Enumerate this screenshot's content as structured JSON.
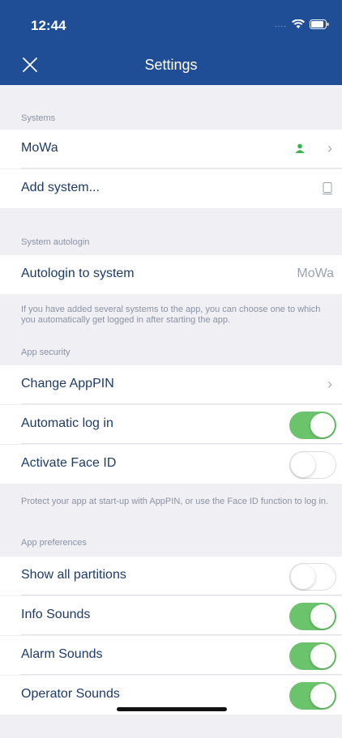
{
  "status": {
    "time": "12:44"
  },
  "header": {
    "title": "Settings"
  },
  "systems": {
    "label": "Systems",
    "items": [
      {
        "label": "MoWa"
      },
      {
        "label": "Add system..."
      }
    ]
  },
  "autologin": {
    "label": "System autologin",
    "row_label": "Autologin to system",
    "row_value": "MoWa",
    "note": "If you have added several systems to the app, you can choose one to which you automatically get logged in after starting the app."
  },
  "security": {
    "label": "App security",
    "change_pin": "Change AppPIN",
    "automatic_login": {
      "label": "Automatic log in",
      "on": true
    },
    "face_id": {
      "label": "Activate Face ID",
      "on": false
    },
    "note": "Protect your app at start-up with AppPIN, or use the Face ID function to log in."
  },
  "preferences": {
    "label": "App preferences",
    "show_partitions": {
      "label": "Show all partitions",
      "on": false
    },
    "info_sounds": {
      "label": "Info Sounds",
      "on": true
    },
    "alarm_sounds": {
      "label": "Alarm Sounds",
      "on": true
    },
    "operator_sounds": {
      "label": "Operator Sounds",
      "on": true
    }
  },
  "colors": {
    "header": "#1f4d96",
    "toggle_on": "#6bc46b",
    "user_icon": "#37b34a"
  }
}
